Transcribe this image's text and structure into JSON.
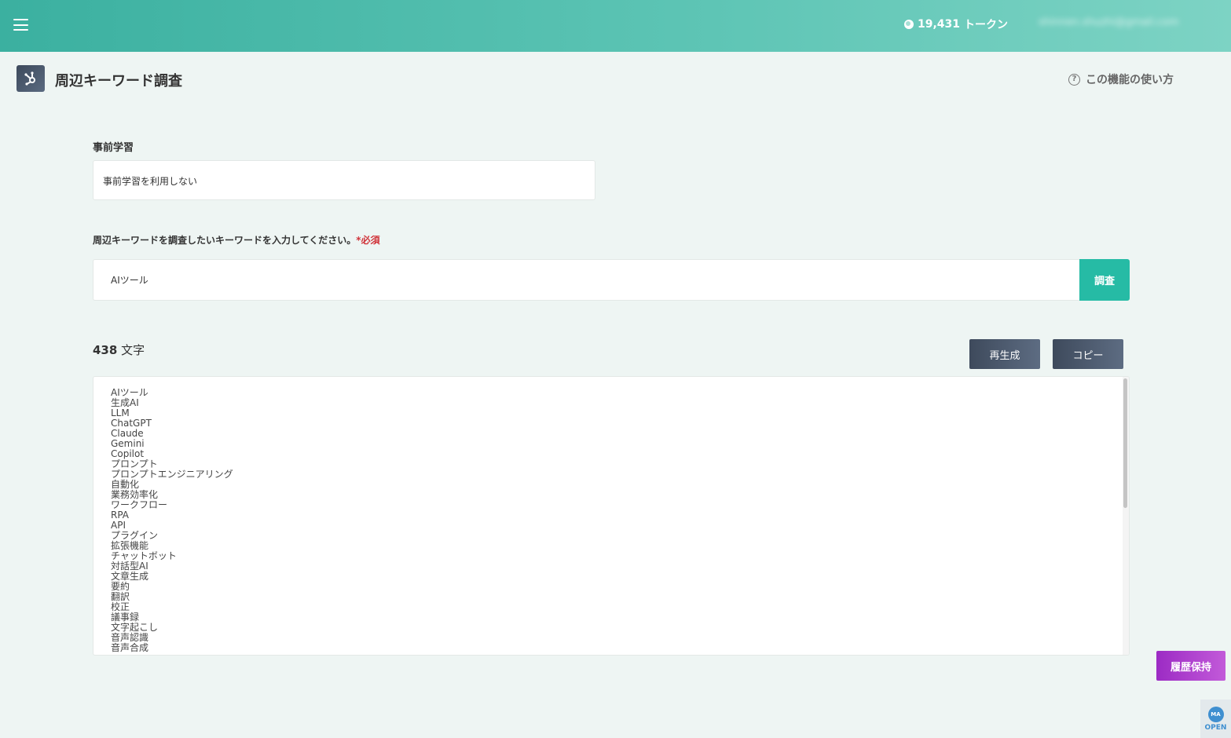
{
  "header": {
    "menu_icon": "hamburger-menu-icon",
    "token_icon": "token-coin-icon",
    "token_count": "19,431",
    "token_unit": "トークン",
    "user_email": "shinnen.shuzhi@gmail.com"
  },
  "page": {
    "icon": "hub-network-icon",
    "title": "周辺キーワード調査",
    "help_icon": "question-circle-icon",
    "help_label": "この機能の使い方"
  },
  "form": {
    "pretraining_label": "事前学習",
    "pretraining_value": "事前学習を利用しない",
    "keyword_label": "周辺キーワードを調査したいキーワードを入力してください。",
    "required_mark": "*必須",
    "keyword_value": "AIツール",
    "search_button": "調査"
  },
  "result": {
    "char_count": "438",
    "char_unit": "文字",
    "regenerate_button": "再生成",
    "copy_button": "コピー",
    "lines": [
      "AIツール",
      "生成AI",
      "LLM",
      "ChatGPT",
      "Claude",
      "Gemini",
      "Copilot",
      "プロンプト",
      "プロンプトエンジニアリング",
      "自動化",
      "業務効率化",
      "ワークフロー",
      "RPA",
      "API",
      "プラグイン",
      "拡張機能",
      "チャットボット",
      "対話型AI",
      "文章生成",
      "要約",
      "翻訳",
      "校正",
      "議事録",
      "文字起こし",
      "音声認識",
      "音声合成"
    ]
  },
  "floating": {
    "history_button": "履歴保持",
    "open_widget_label": "OPEN",
    "open_widget_icon": "chat-widget-icon"
  }
}
